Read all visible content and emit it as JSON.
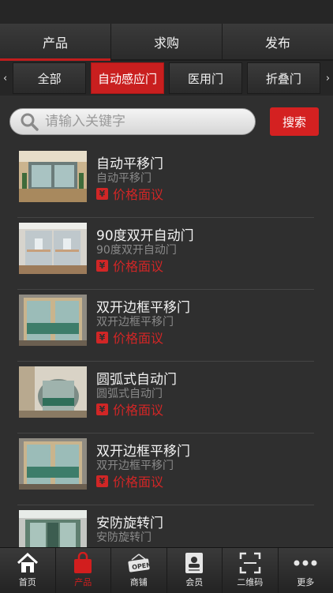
{
  "top_tabs": [
    "产品",
    "求购",
    "发布"
  ],
  "categories": {
    "left_arrow": "‹",
    "right_arrow": "›",
    "items": [
      "全部",
      "自动感应门",
      "医用门",
      "折叠门"
    ]
  },
  "search": {
    "placeholder": "请输入关键字",
    "button": "搜索"
  },
  "products": [
    {
      "title": "自动平移门",
      "subtitle": "自动平移门",
      "price": "价格面议"
    },
    {
      "title": "90度双开自动门",
      "subtitle": "90度双开自动门",
      "price": "价格面议"
    },
    {
      "title": "双开边框平移门",
      "subtitle": "双开边框平移门",
      "price": "价格面议"
    },
    {
      "title": "圆弧式自动门",
      "subtitle": "圆弧式自动门",
      "price": "价格面议"
    },
    {
      "title": "双开边框平移门",
      "subtitle": "双开边框平移门",
      "price": "价格面议"
    },
    {
      "title": "安防旋转门",
      "subtitle": "安防旋转门",
      "price": ""
    }
  ],
  "yen_symbol": "¥",
  "bottom_nav": [
    "首页",
    "产品",
    "商铺",
    "会员",
    "二维码",
    "更多"
  ],
  "colors": {
    "accent": "#d12626",
    "background": "#2f2f2f"
  }
}
